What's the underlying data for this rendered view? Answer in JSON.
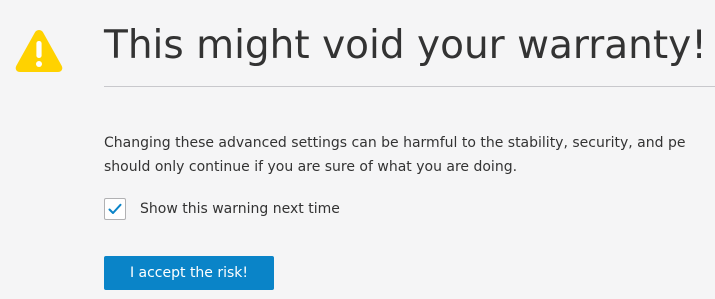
{
  "icon": "warning-icon",
  "colors": {
    "background": "#f5f5f6",
    "warning_yellow": "#ffd200",
    "accent_blue": "#0a84c8",
    "text": "#333333"
  },
  "title": "This might void your warranty!",
  "description": {
    "line1": "Changing these advanced settings can be harmful to the stability, security, and pe",
    "line2": "should only continue if you are sure of what you are doing."
  },
  "checkbox": {
    "label": "Show this warning next time",
    "checked": true
  },
  "accept_button": {
    "label": "I accept the risk!"
  }
}
